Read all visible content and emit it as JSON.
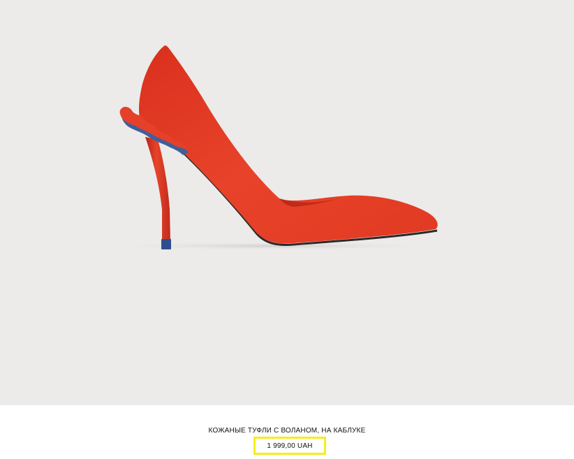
{
  "product": {
    "name": "КОЖАНЫЕ ТУФЛИ С ВОЛАНОМ, НА КАБЛУКЕ",
    "price": "1 999,00 UAH",
    "image_subject": "red-pump-shoe-with-ruffle"
  },
  "colors": {
    "image_background": "#ecebe9",
    "shoe_red": "#e23a22",
    "ruffle_blue": "#3f5f9c",
    "price_highlight": "#f7ed1c"
  }
}
